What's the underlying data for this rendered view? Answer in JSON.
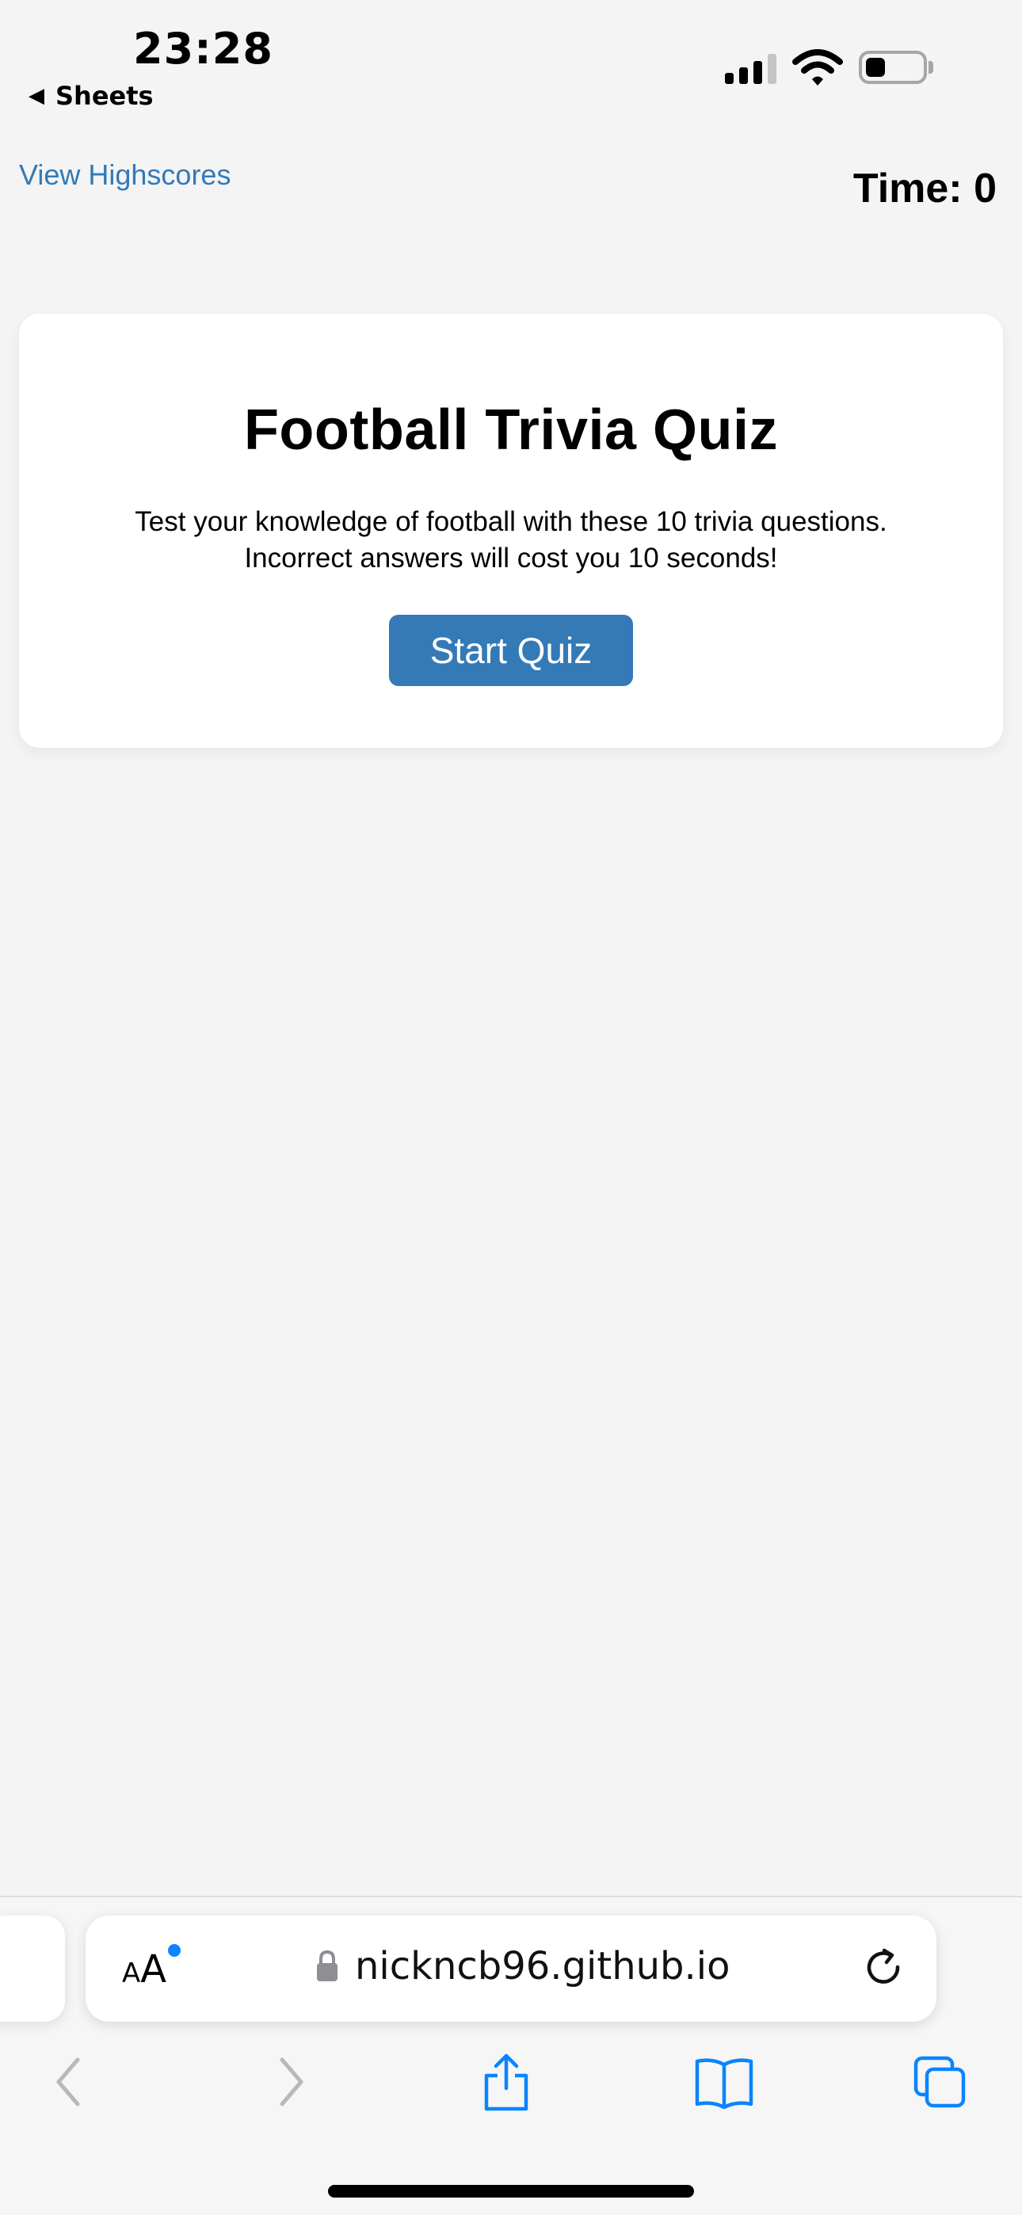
{
  "status_bar": {
    "time": "23:28",
    "back_app": "Sheets"
  },
  "header": {
    "highscores_link": "View Highscores",
    "timer": "Time: 0"
  },
  "quiz_card": {
    "title": "Football Trivia Quiz",
    "description": "Test your knowledge of football with these 10 trivia questions. Incorrect answers will cost you 10 seconds!",
    "start_button": "Start Quiz"
  },
  "browser": {
    "text_size_button": "AA",
    "url": "nickncb96.github.io",
    "toolbar_icons": [
      "back-icon",
      "forward-icon",
      "share-icon",
      "bookmarks-icon",
      "tabs-icon"
    ]
  },
  "colors": {
    "accent": "#337ab7",
    "safari_blue": "#0a84ff",
    "background": "#f4f4f4"
  }
}
